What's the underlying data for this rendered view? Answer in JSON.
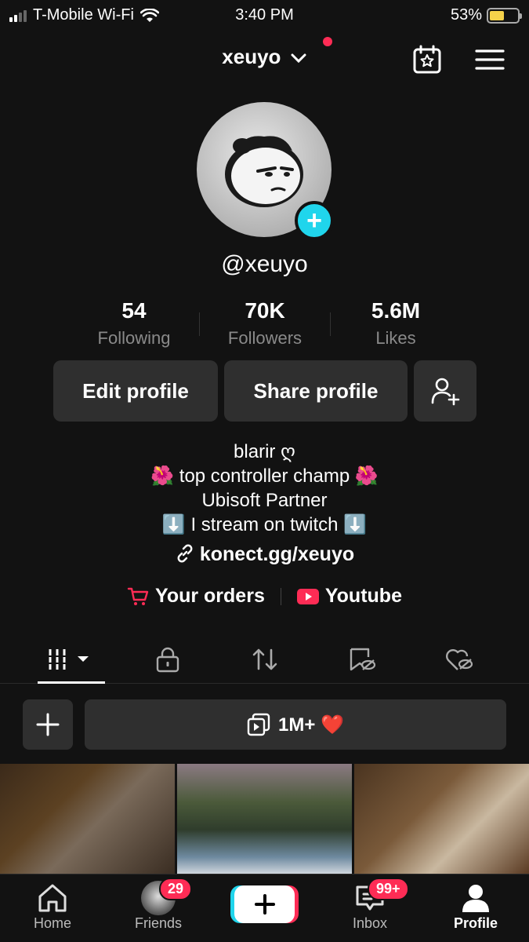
{
  "status_bar": {
    "carrier": "T-Mobile Wi-Fi",
    "time": "3:40 PM",
    "battery": "53%",
    "battery_level": 0.53
  },
  "header": {
    "username": "xeuyo"
  },
  "profile": {
    "handle": "@xeuyo",
    "stats": [
      {
        "value": "54",
        "label": "Following"
      },
      {
        "value": "70K",
        "label": "Followers"
      },
      {
        "value": "5.6M",
        "label": "Likes"
      }
    ],
    "buttons": {
      "edit": "Edit profile",
      "share": "Share profile"
    },
    "bio": [
      "blarir ღ",
      "🌺 top controller champ 🌺",
      "Ubisoft Partner",
      "⬇️ I stream on twitch ⬇️"
    ],
    "link": "konect.gg/xeuyo",
    "extras": {
      "orders": "Your orders",
      "youtube": "Youtube"
    }
  },
  "collection": {
    "label": "1M+ ❤️"
  },
  "nav": {
    "home": "Home",
    "friends": "Friends",
    "friends_badge": "29",
    "inbox": "Inbox",
    "inbox_badge": "99+",
    "profile": "Profile"
  },
  "colors": {
    "background": "#121212",
    "accent_red": "#fe2c55",
    "accent_cyan": "#20d5ec",
    "button_bg": "#2f2f2f"
  }
}
